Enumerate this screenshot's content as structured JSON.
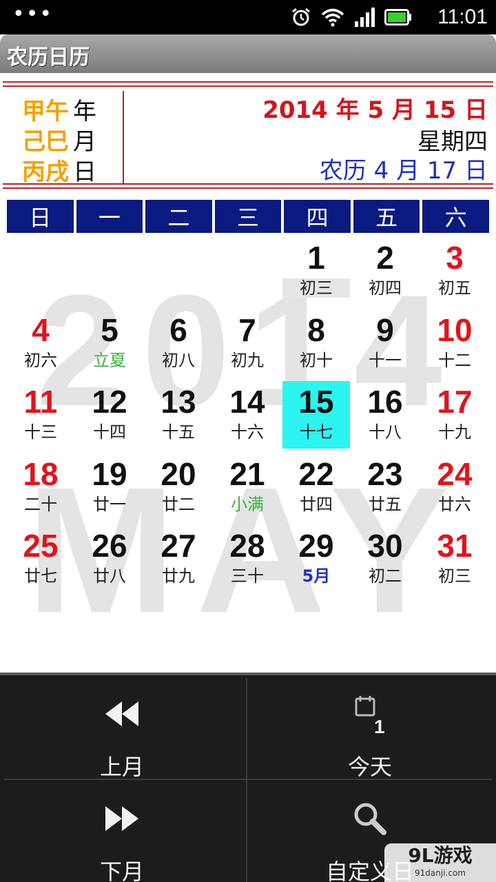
{
  "status_bar": {
    "time": "11:01",
    "icons": [
      "overflow-dots-icon",
      "alarm-icon",
      "wifi-icon",
      "signal-icon",
      "battery-icon"
    ]
  },
  "app": {
    "title": "农历日历"
  },
  "header": {
    "ganzhi": [
      {
        "gz": "甲午",
        "unit": "年"
      },
      {
        "gz": "己巳",
        "unit": "月"
      },
      {
        "gz": "丙戌",
        "unit": "日"
      }
    ],
    "gregorian_date": "2014 年 5 月 15 日",
    "weekday": "星期四",
    "lunar_date": "农历 4 月 17 日"
  },
  "watermark": {
    "year": "2014",
    "month": "MAY"
  },
  "weekdays": [
    "日",
    "一",
    "二",
    "三",
    "四",
    "五",
    "六"
  ],
  "days": [
    {
      "day": "1",
      "lunar": "初三",
      "col": 4,
      "row": 0
    },
    {
      "day": "2",
      "lunar": "初四",
      "col": 5,
      "row": 0
    },
    {
      "day": "3",
      "lunar": "初五",
      "col": 6,
      "row": 0
    },
    {
      "day": "4",
      "lunar": "初六",
      "col": 0,
      "row": 1
    },
    {
      "day": "5",
      "lunar": "立夏",
      "col": 1,
      "row": 1,
      "kind": "term"
    },
    {
      "day": "6",
      "lunar": "初八",
      "col": 2,
      "row": 1
    },
    {
      "day": "7",
      "lunar": "初九",
      "col": 3,
      "row": 1
    },
    {
      "day": "8",
      "lunar": "初十",
      "col": 4,
      "row": 1
    },
    {
      "day": "9",
      "lunar": "十一",
      "col": 5,
      "row": 1
    },
    {
      "day": "10",
      "lunar": "十二",
      "col": 6,
      "row": 1
    },
    {
      "day": "11",
      "lunar": "十三",
      "col": 0,
      "row": 2
    },
    {
      "day": "12",
      "lunar": "十四",
      "col": 1,
      "row": 2
    },
    {
      "day": "13",
      "lunar": "十五",
      "col": 2,
      "row": 2
    },
    {
      "day": "14",
      "lunar": "十六",
      "col": 3,
      "row": 2
    },
    {
      "day": "15",
      "lunar": "十七",
      "col": 4,
      "row": 2,
      "today": true
    },
    {
      "day": "16",
      "lunar": "十八",
      "col": 5,
      "row": 2
    },
    {
      "day": "17",
      "lunar": "十九",
      "col": 6,
      "row": 2
    },
    {
      "day": "18",
      "lunar": "二十",
      "col": 0,
      "row": 3
    },
    {
      "day": "19",
      "lunar": "廿一",
      "col": 1,
      "row": 3
    },
    {
      "day": "20",
      "lunar": "廿二",
      "col": 2,
      "row": 3
    },
    {
      "day": "21",
      "lunar": "小满",
      "col": 3,
      "row": 3,
      "kind": "term"
    },
    {
      "day": "22",
      "lunar": "廿四",
      "col": 4,
      "row": 3
    },
    {
      "day": "23",
      "lunar": "廿五",
      "col": 5,
      "row": 3
    },
    {
      "day": "24",
      "lunar": "廿六",
      "col": 6,
      "row": 3
    },
    {
      "day": "25",
      "lunar": "廿七",
      "col": 0,
      "row": 4
    },
    {
      "day": "26",
      "lunar": "廿八",
      "col": 1,
      "row": 4
    },
    {
      "day": "27",
      "lunar": "廿九",
      "col": 2,
      "row": 4
    },
    {
      "day": "28",
      "lunar": "三十",
      "col": 3,
      "row": 4
    },
    {
      "day": "29",
      "lunar": "5月",
      "col": 4,
      "row": 4,
      "kind": "lmonth"
    },
    {
      "day": "30",
      "lunar": "初二",
      "col": 5,
      "row": 4
    },
    {
      "day": "31",
      "lunar": "初三",
      "col": 6,
      "row": 4
    }
  ],
  "toolbar": {
    "prev_month": "上月",
    "today": "今天",
    "today_icon_number": "1",
    "next_month": "下月",
    "custom_date": "自定义日"
  },
  "watermark_logo": {
    "brand": "9L游戏",
    "site": "91danji.com"
  },
  "colors": {
    "weekend": "#e0141c",
    "solar_term": "#3fae3f",
    "lunar_month": "#1f2fd0",
    "today_bg": "#2cf4f0",
    "weekday_header": "#0b1a80",
    "ganzhi": "#f5a000"
  }
}
